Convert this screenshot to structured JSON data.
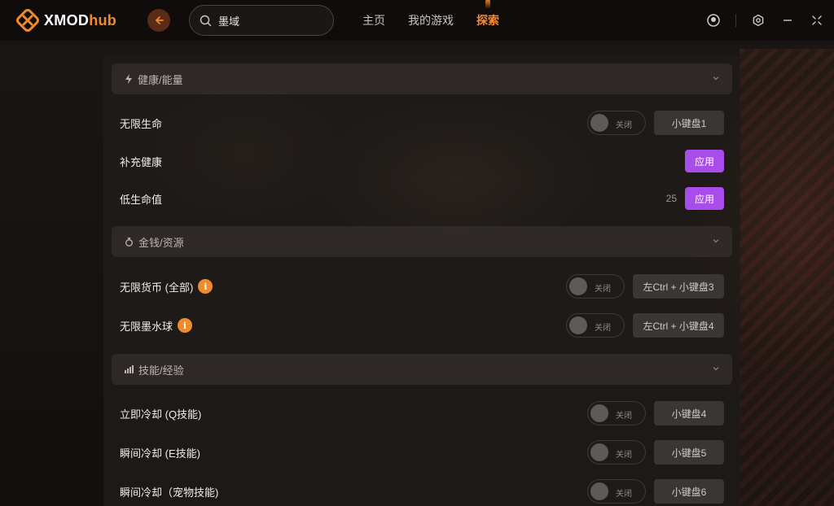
{
  "app": {
    "logo_main": "XMOD",
    "logo_accent": "hub"
  },
  "search": {
    "value": "墨域",
    "placeholder": ""
  },
  "nav": {
    "home": "主页",
    "my_games": "我的游戏",
    "explore": "探索"
  },
  "colors": {
    "accent": "#f08a2a",
    "apply": "#a94dea"
  },
  "sections": [
    {
      "title": "健康/能量",
      "icon": "lightning-icon",
      "rows": [
        {
          "label": "无限生命",
          "toggle": "关闭",
          "hotkey": "小键盘1"
        },
        {
          "label": "补充健康",
          "apply": "应用"
        },
        {
          "label": "低生命值",
          "value": "25",
          "apply": "应用"
        }
      ]
    },
    {
      "title": "金钱/资源",
      "icon": "money-bag-icon",
      "rows": [
        {
          "label": "无限货币 (全部)",
          "info": "i",
          "toggle": "关闭",
          "hotkey": "左Ctrl + 小键盘3"
        },
        {
          "label": "无限墨水球",
          "info": "i",
          "toggle": "关闭",
          "hotkey": "左Ctrl + 小键盘4"
        }
      ]
    },
    {
      "title": "技能/经验",
      "icon": "bar-chart-icon",
      "rows": [
        {
          "label": "立即冷却 (Q技能)",
          "toggle": "关闭",
          "hotkey": "小键盘4"
        },
        {
          "label": "瞬间冷却 (E技能)",
          "toggle": "关闭",
          "hotkey": "小键盘5"
        },
        {
          "label": "瞬间冷却（宠物技能)",
          "toggle": "关闭",
          "hotkey": "小键盘6"
        }
      ]
    }
  ]
}
